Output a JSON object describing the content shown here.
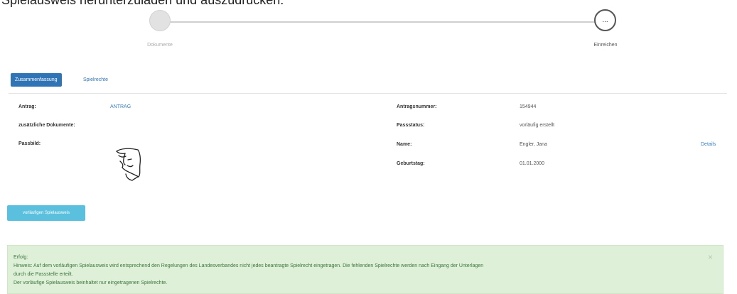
{
  "intro_text": "Spielausweis herunterzuladen und auszudrucken.",
  "stepper": {
    "steps": [
      {
        "label": "Dokumente",
        "icon": ""
      },
      {
        "label": "Einreichen",
        "icon": "..."
      }
    ]
  },
  "tabs": [
    {
      "label": "Zusammenfassung",
      "active": true
    },
    {
      "label": "Spielrechte",
      "active": false
    }
  ],
  "summary": {
    "antrag_label": "Antrag:",
    "antrag_link": "ANTRAG",
    "zusatz_label": "zusätzliche Dokumente:",
    "passbild_label": "Passbild:",
    "antragsnummer_label": "Antragsnummer:",
    "antragsnummer_value": "154944",
    "passstatus_label": "Passstatus:",
    "passstatus_value": "vorläufig erstellt",
    "name_label": "Name:",
    "name_value": "Engler, Jana",
    "details_link": "Details",
    "geburtstag_label": "Geburtstag:",
    "geburtstag_value": "01.01.2000"
  },
  "primary_button": "vorläufigen Spielausweis",
  "alert": {
    "title": "Erfolg:",
    "line1": "Hinweis: Auf dem vorläufigen Spielausweis wird entsprechend den Regelungen des Landesverbandes nicht jedes beantragte Spielrecht eingetragen. Die fehlenden Spielrechte werden nach Eingang der Unterlagen",
    "line2": "durch die Passstelle erteilt.",
    "line3": "Der vorläufige Spielausweis beinhaltet nur eingetragenen Spielrechte.",
    "close": "×"
  },
  "colors": {
    "tab_active": "#2f74b5",
    "button": "#5bc0de",
    "alert_bg": "#dff0d8",
    "alert_text": "#3c763d"
  }
}
